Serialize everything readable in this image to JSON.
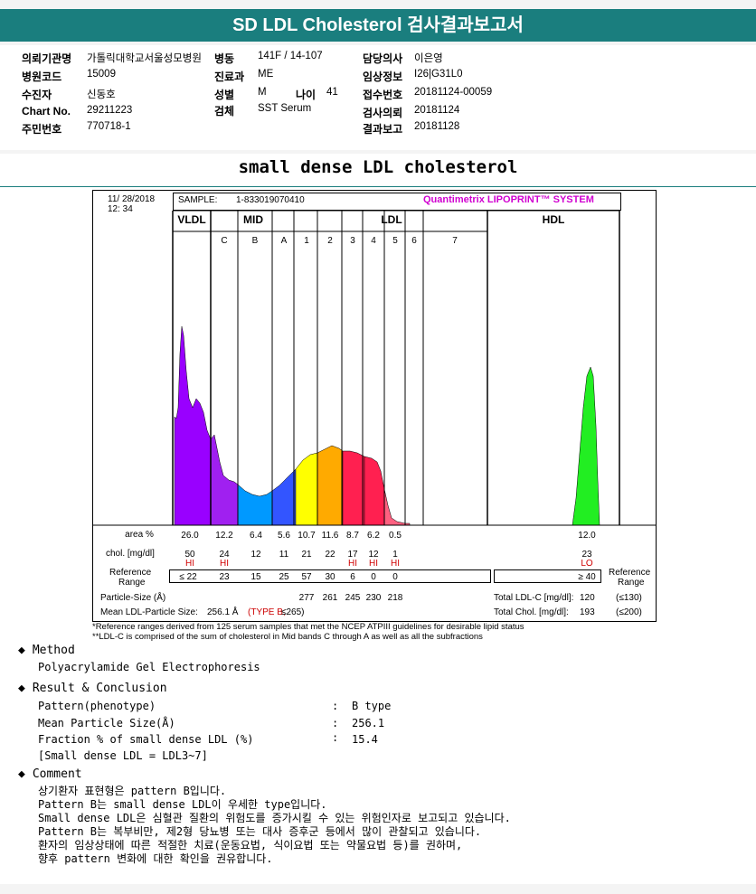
{
  "title": "SD LDL Cholesterol 검사결과보고서",
  "info": {
    "hospital_label": "의뢰기관명",
    "hospital": "가톨릭대학교서울성모병원",
    "ward_label": "병동",
    "ward": "141F / 14-107",
    "doctor_label": "담당의사",
    "doctor": "이은영",
    "code_label": "병원코드",
    "code": "15009",
    "dept_label": "진료과",
    "dept": "ME",
    "clinical_label": "임상정보",
    "clinical": "I26|G31L0",
    "patient_label": "수진자",
    "patient": "신동호",
    "sex_label": "성별",
    "sex": "M",
    "age_label": "나이",
    "age": "41",
    "receipt_label": "접수번호",
    "receipt": "20181124-00059",
    "chart_label": "Chart No.",
    "chart": "29211223",
    "specimen_label": "검체",
    "specimen": "SST Serum",
    "request_label": "검사의뢰",
    "request": "20181124",
    "resident_label": "주민번호",
    "resident": "770718-1",
    "report_label": "결과보고",
    "report": "20181128"
  },
  "subtitle": "small dense LDL cholesterol",
  "chart_data": {
    "type": "area",
    "date": "11/ 28/2018",
    "time": "12: 34",
    "sample_label": "SAMPLE:",
    "sample": "1-833019070410",
    "brand": "Quantimetrix LIPOPRINT™ SYSTEM",
    "groups": [
      "VLDL",
      "MID",
      "LDL",
      "HDL"
    ],
    "bands": [
      "C",
      "B",
      "A",
      "1",
      "2",
      "3",
      "4",
      "5",
      "6",
      "7"
    ],
    "band_colors": {
      "VLDL": "#9900ff",
      "C": "#a020f0",
      "B": "#0099ff",
      "A": "#3355ff",
      "1": "#ffff00",
      "2": "#ffaa00",
      "3": "#ff2050",
      "4": "#ff2050",
      "5": "#ff6080",
      "HDL": "#22ee22"
    },
    "rows": {
      "area_label": "area %",
      "area": [
        "26.0",
        "12.2",
        "6.4",
        "5.6",
        "10.7",
        "11.6",
        "8.7",
        "6.2",
        "0.5",
        "12.0"
      ],
      "chol_label": "chol. [mg/dl]",
      "chol": [
        "50",
        "24",
        "12",
        "11",
        "21",
        "22",
        "17",
        "12",
        "1",
        "23"
      ],
      "flags": [
        "HI",
        "HI",
        "",
        "",
        "",
        "",
        "HI",
        "HI",
        "HI",
        "LO"
      ],
      "ref_label_1": "Reference",
      "ref_label_2": "Range",
      "ref": [
        "≤ 22",
        "23",
        "15",
        "25",
        "57",
        "30",
        "6",
        "0",
        "0"
      ],
      "ref_hdl": "≥ 40",
      "size_label": "Particle-Size (Å)",
      "sizes": [
        "277",
        "261",
        "245",
        "230",
        "218"
      ],
      "total_ldl_label": "Total LDL-C [mg/dl]:",
      "total_ldl": "120",
      "total_ldl_ref": "(≤130)",
      "mean_label": "Mean LDL-Particle Size:",
      "mean": "256.1 Å",
      "type": "(TYPE B;",
      "type_ref": "≤265)",
      "total_chol_label": "Total Chol. [mg/dl]:",
      "total_chol": "193",
      "total_chol_ref": "(≤200)"
    }
  },
  "footnote_1": "*Reference ranges derived from 125 serum samples that met the NCEP ATPIII guidelines for desirable lipid status",
  "footnote_2": "**LDL-C is comprised of the sum of cholesterol in Mid bands C through A as well as all the subfractions",
  "method_head": "Method",
  "method": "Polyacrylamide Gel Electrophoresis",
  "result_head": "Result & Conclusion",
  "results": [
    {
      "label": "Pattern(phenotype)",
      "value": "B type"
    },
    {
      "label": "Mean Particle Size(Å)",
      "value": "256.1"
    },
    {
      "label": "Fraction % of small dense LDL (%)",
      "value": "15.4"
    }
  ],
  "result_note": "[Small dense LDL = LDL3~7]",
  "comment_head": "Comment",
  "comments": [
    "상기환자 표현형은 pattern B입니다.",
    "Pattern B는 small dense LDL이 우세한 type입니다.",
    "Small dense LDL은 심혈관 질환의 위험도를 증가시킬 수 있는 위험인자로 보고되고 있습니다.",
    "Pattern B는 복부비만, 제2형 당뇨병 또는 대사 증후군 등에서 많이 관찰되고 있습니다.",
    "환자의 임상상태에 따른 적절한 치료(운동요법, 식이요법 또는 약물요법 등)를 권하며,",
    "향후 pattern 변화에 대한 확인을 권유합니다."
  ]
}
